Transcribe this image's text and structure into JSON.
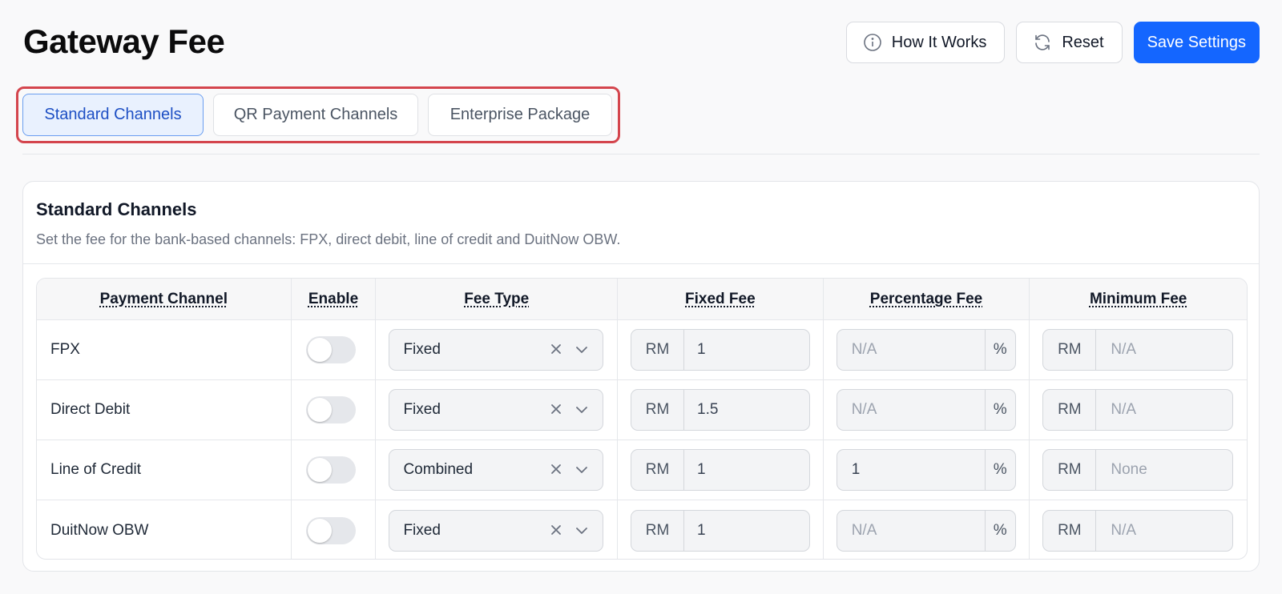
{
  "header": {
    "title": "Gateway Fee",
    "how_it_works_label": "How It Works",
    "reset_label": "Reset",
    "save_label": "Save Settings"
  },
  "tabs": [
    {
      "label": "Standard Channels",
      "active": true
    },
    {
      "label": "QR Payment Channels",
      "active": false
    },
    {
      "label": "Enterprise Package",
      "active": false
    }
  ],
  "card": {
    "title": "Standard Channels",
    "description": "Set the fee for the bank-based channels: FPX, direct debit, line of credit and DuitNow OBW."
  },
  "table": {
    "columns": [
      "Payment Channel",
      "Enable",
      "Fee Type",
      "Fixed Fee",
      "Percentage Fee",
      "Minimum Fee"
    ],
    "rows": [
      {
        "channel": "FPX",
        "enabled": false,
        "fee_type": "Fixed",
        "fixed_currency": "RM",
        "fixed_fee": "1",
        "percentage_fee": "N/A",
        "percentage_unit": "%",
        "min_currency": "RM",
        "min_fee": "N/A"
      },
      {
        "channel": "Direct Debit",
        "enabled": false,
        "fee_type": "Fixed",
        "fixed_currency": "RM",
        "fixed_fee": "1.5",
        "percentage_fee": "N/A",
        "percentage_unit": "%",
        "min_currency": "RM",
        "min_fee": "N/A"
      },
      {
        "channel": "Line of Credit",
        "enabled": false,
        "fee_type": "Combined",
        "fixed_currency": "RM",
        "fixed_fee": "1",
        "percentage_fee": "1",
        "percentage_unit": "%",
        "min_currency": "RM",
        "min_fee": "None"
      },
      {
        "channel": "DuitNow OBW",
        "enabled": false,
        "fee_type": "Fixed",
        "fixed_currency": "RM",
        "fixed_fee": "1",
        "percentage_fee": "N/A",
        "percentage_unit": "%",
        "min_currency": "RM",
        "min_fee": "N/A"
      }
    ]
  },
  "colors": {
    "primary": "#1466ff",
    "active_tab_bg": "#e9f1fe",
    "active_tab_text": "#1d4fc4",
    "highlight_border": "#d4454d",
    "toggle_off": "#e5e7eb"
  },
  "icons": {
    "how_it_works": "info-circle-icon",
    "reset": "refresh-icon",
    "clear": "close-icon",
    "dropdown": "chevron-down-icon"
  }
}
